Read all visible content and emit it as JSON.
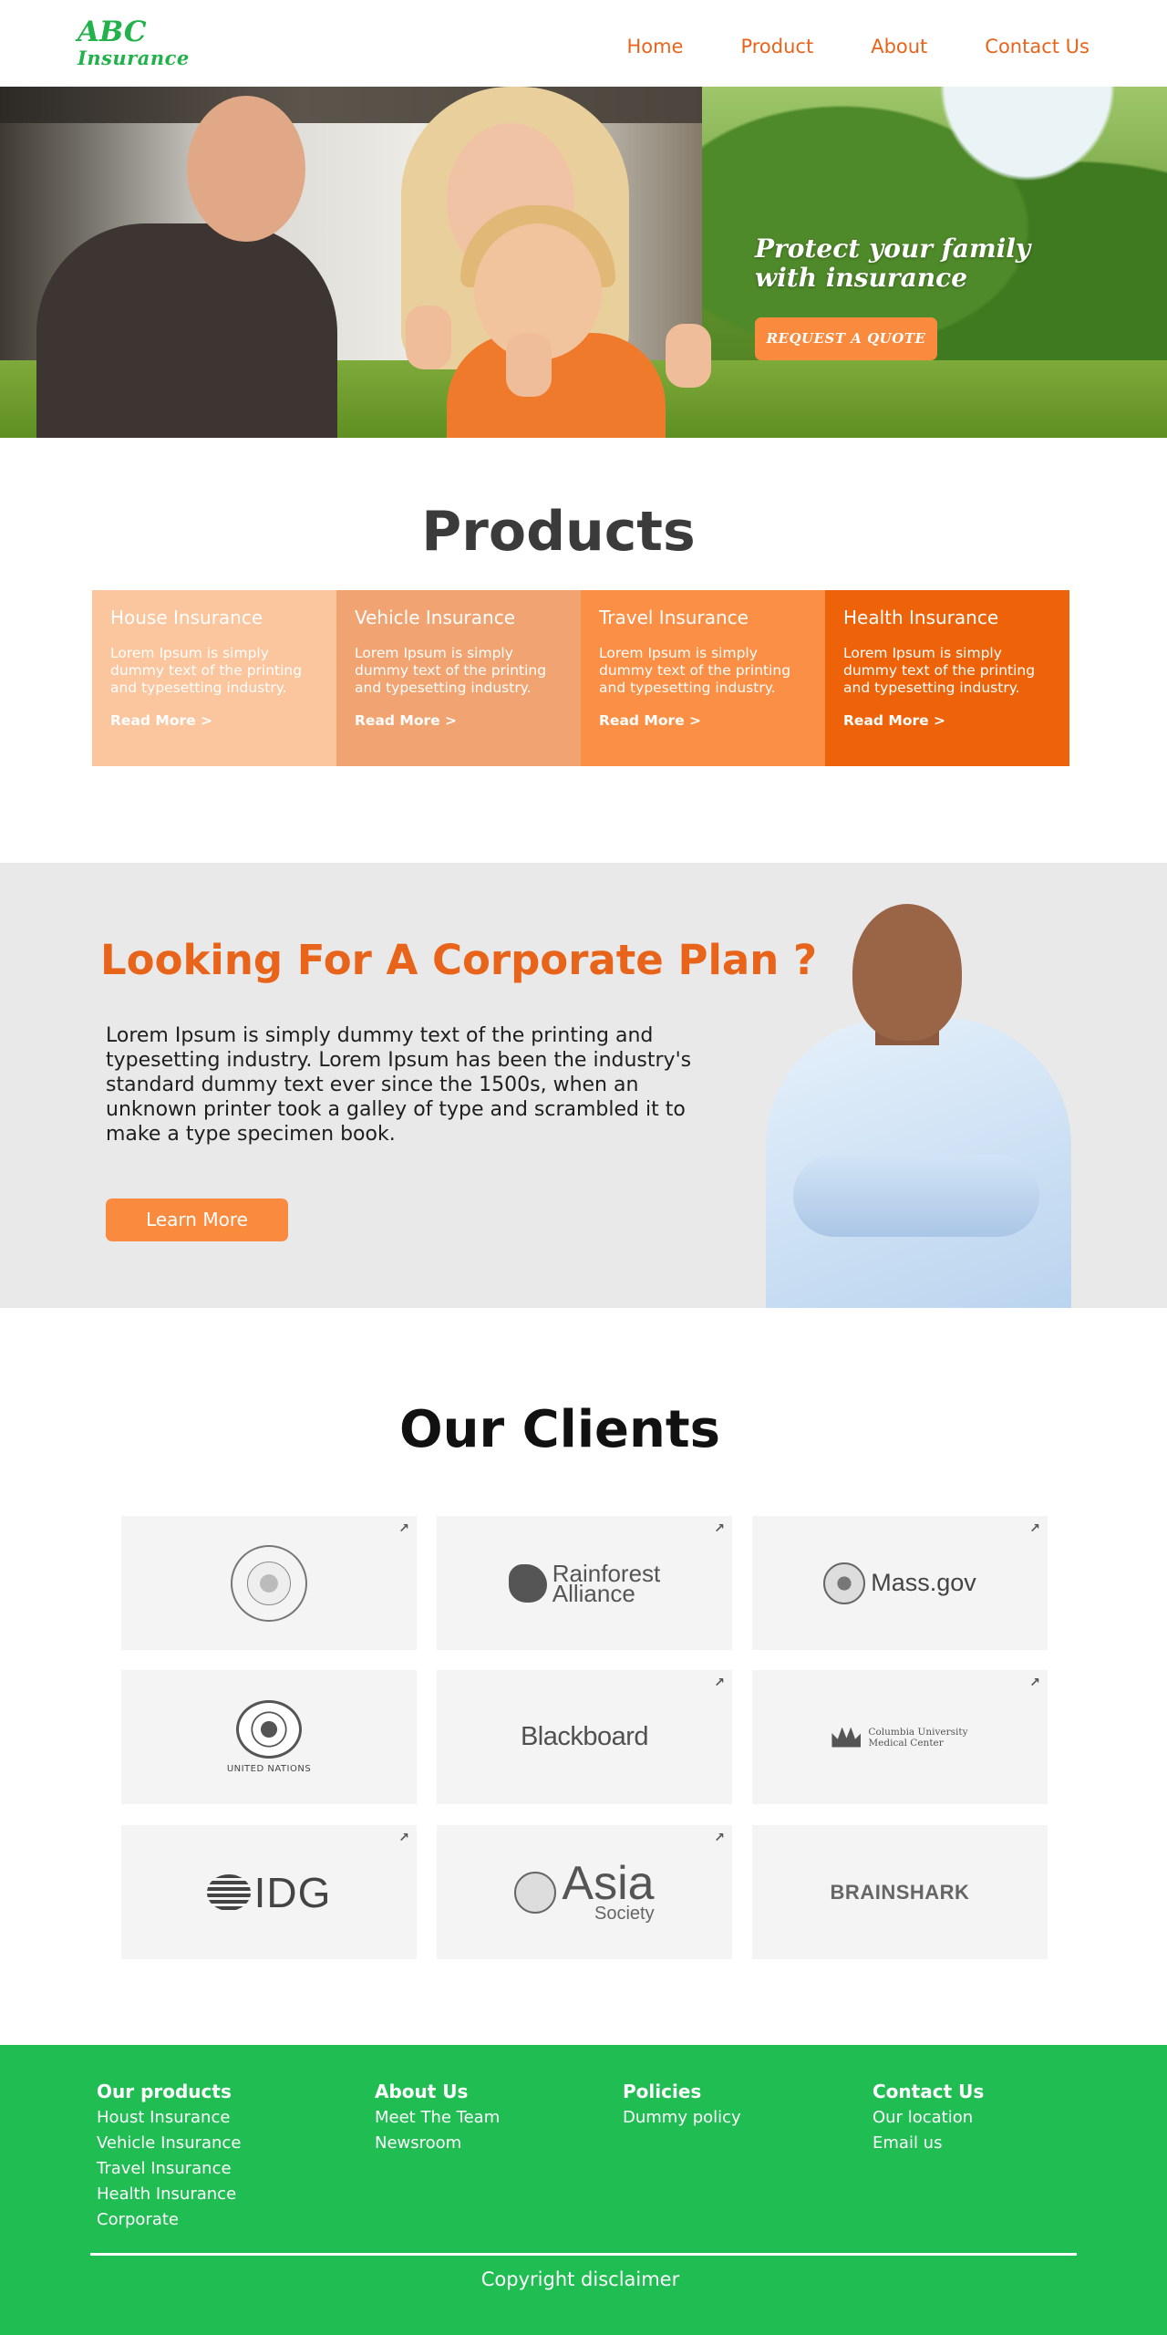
{
  "header": {
    "logo_line1": "ABC",
    "logo_line2": "Insurance",
    "nav": [
      "Home",
      "Product",
      "About",
      "Contact Us"
    ]
  },
  "hero": {
    "tagline_line1": "Protect your family",
    "tagline_line2": "with insurance",
    "cta": "REQUEST A QUOTE"
  },
  "products": {
    "title": "Products",
    "cards": [
      {
        "title": "House Insurance",
        "desc": "Lorem Ipsum is simply dummy text of the printing and typesetting industry.",
        "link": "Read More >",
        "color": "#fbc59e"
      },
      {
        "title": "Vehicle Insurance",
        "desc": "Lorem Ipsum is simply dummy text of the printing and typesetting industry.",
        "link": "Read More >",
        "color": "#f1a471"
      },
      {
        "title": "Travel Insurance",
        "desc": "Lorem Ipsum is simply dummy text of the printing and typesetting industry.",
        "link": "Read More >",
        "color": "#fb8f45"
      },
      {
        "title": "Health Insurance",
        "desc": "Lorem Ipsum is simply dummy text of the printing and typesetting industry.",
        "link": "Read More >",
        "color": "#ee6309"
      }
    ]
  },
  "corporate": {
    "title": "Looking For A Corporate Plan ?",
    "text": "Lorem Ipsum is simply dummy text of the printing and typesetting industry. Lorem Ipsum has been the industry's standard dummy text ever since the 1500s, when an unknown printer took a galley of type and scrambled it to make a type specimen book.",
    "button": "Learn More"
  },
  "clients": {
    "title": "Our Clients",
    "logos": {
      "rainforest_1": "Rainforest",
      "rainforest_2": "Alliance",
      "mass": "Mass.gov",
      "un": "UNITED NATIONS",
      "blackboard": "Blackboard",
      "cumc_1": "Columbia University",
      "cumc_2": "Medical Center",
      "idg": "IDG",
      "asia_1": "Asia",
      "asia_2": "Society",
      "brainshark": "BRAINSHARK"
    }
  },
  "footer": {
    "cols": [
      {
        "heading": "Our products",
        "links": [
          "Houst Insurance",
          "Vehicle Insurance",
          "Travel Insurance",
          "Health Insurance",
          "Corporate"
        ]
      },
      {
        "heading": "About Us",
        "links": [
          "Meet The Team",
          "Newsroom"
        ]
      },
      {
        "heading": "Policies",
        "links": [
          "Dummy policy"
        ]
      },
      {
        "heading": "Contact Us",
        "links": [
          "Our location",
          "Email us"
        ]
      }
    ],
    "copyright": "Copyright disclaimer"
  },
  "colors": {
    "brand_green": "#22b24c",
    "accent_orange": "#e8641b",
    "button_orange": "#fa8b3e",
    "footer_green": "#1fbd52"
  }
}
